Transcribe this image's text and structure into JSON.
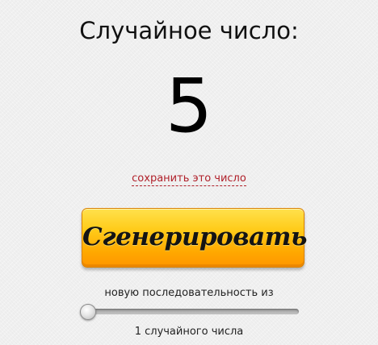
{
  "title": "Случайное число:",
  "result": {
    "value": "5"
  },
  "save_link": {
    "label": "сохранить это число",
    "color": "#b0202a"
  },
  "generate_button": {
    "label": "Сгенерировать",
    "color": "#ffb300"
  },
  "sequence": {
    "label": "новую последовательность из",
    "slider_value": 1,
    "count_text": "1 случайного числа"
  }
}
